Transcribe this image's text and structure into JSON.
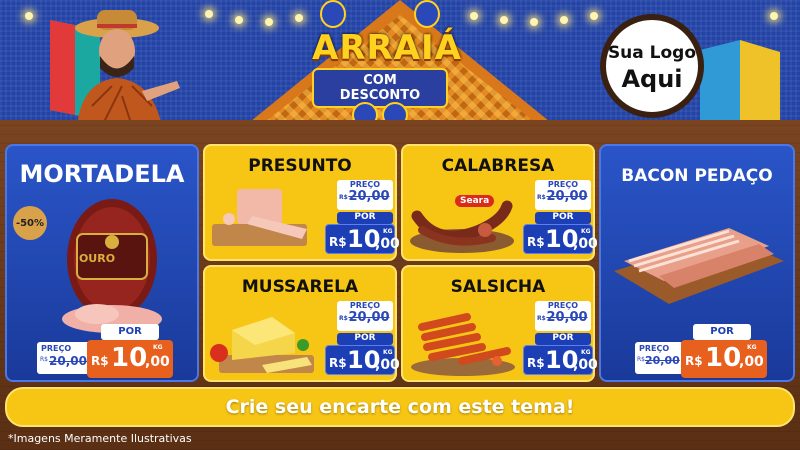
{
  "header": {
    "logo_line1": "ARRAIÁ",
    "logo_line2": "COM DESCONTO",
    "placeholder_line1": "Sua Logo",
    "placeholder_line2": "Aqui"
  },
  "products": {
    "mortadela": {
      "name": "MORTADELA",
      "badge": "-50%",
      "brand": "OURO",
      "old_label": "PREÇO",
      "old_price": "20,00",
      "old_prefix": "R$",
      "por_label": "POR",
      "currency": "R$",
      "price_int": "10",
      "price_cents": ",00",
      "unit": "KG"
    },
    "presunto": {
      "name": "PRESUNTO",
      "old_label": "PREÇO",
      "old_price": "20,00",
      "old_prefix": "R$",
      "por_label": "POR",
      "currency": "R$",
      "price_int": "10",
      "price_cents": ",00",
      "unit": "KG"
    },
    "calabresa": {
      "name": "CALABRESA",
      "brand": "Seara",
      "old_label": "PREÇO",
      "old_price": "20,00",
      "old_prefix": "R$",
      "por_label": "POR",
      "currency": "R$",
      "price_int": "10",
      "price_cents": ",00",
      "unit": "KG"
    },
    "bacon": {
      "name": "BACON PEDAÇO",
      "old_label": "PREÇO",
      "old_price": "20,00",
      "old_prefix": "R$",
      "por_label": "POR",
      "currency": "R$",
      "price_int": "10",
      "price_cents": ",00",
      "unit": "KG"
    },
    "mussarela": {
      "name": "MUSSARELA",
      "old_label": "PREÇO",
      "old_price": "20,00",
      "old_prefix": "R$",
      "por_label": "POR",
      "currency": "R$",
      "price_int": "10",
      "price_cents": ",00",
      "unit": "KG"
    },
    "salsicha": {
      "name": "SALSICHA",
      "old_label": "PREÇO",
      "old_price": "20,00",
      "old_prefix": "R$",
      "por_label": "POR",
      "currency": "R$",
      "price_int": "10",
      "price_cents": ",00",
      "unit": "KG"
    }
  },
  "footer": {
    "cta": "Crie seu encarte com este tema!",
    "disclaimer": "*Imagens Meramente Ilustrativas"
  },
  "colors": {
    "blue_panel": "#1a3a9a",
    "yellow_panel": "#f7c514",
    "wood": "#6a3a18",
    "price_blue": "#1d3fb5",
    "accent_orange": "#e38a22"
  }
}
